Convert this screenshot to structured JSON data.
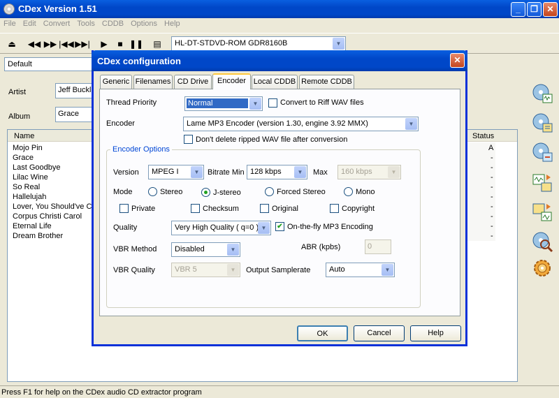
{
  "app": {
    "title": "CDex Version 1.51",
    "menu": [
      "File",
      "Edit",
      "Convert",
      "Tools",
      "CDDB",
      "Options",
      "Help"
    ],
    "drive": "HL-DT-STDVD-ROM GDR8160B",
    "profile": "Default",
    "artist_label": "Artist",
    "artist_value": "Jeff Buckl",
    "album_label": "Album",
    "album_value": "Grace",
    "list": {
      "col_name": "Name",
      "col_status": "Status",
      "tracks": [
        {
          "name": "Mojo Pin",
          "status": "A"
        },
        {
          "name": "Grace",
          "status": "-"
        },
        {
          "name": "Last Goodbye",
          "status": "-"
        },
        {
          "name": "Lilac Wine",
          "status": "-"
        },
        {
          "name": "So Real",
          "status": "-"
        },
        {
          "name": "Hallelujah",
          "status": "-"
        },
        {
          "name": "Lover, You Should've C",
          "status": "-"
        },
        {
          "name": "Corpus Christi Carol",
          "status": "-"
        },
        {
          "name": "Eternal Life",
          "status": "-"
        },
        {
          "name": "Dream Brother",
          "status": "-"
        }
      ]
    },
    "statusbar": "Press F1 for help on the CDex audio CD extractor program"
  },
  "dialog": {
    "title": "CDex configuration",
    "tabs": [
      "Generic",
      "Filenames",
      "CD Drive",
      "Encoder",
      "Local CDDB",
      "Remote CDDB"
    ],
    "active_tab": "Encoder",
    "thread_priority_label": "Thread Priority",
    "thread_priority_value": "Normal",
    "convert_riff_label": "Convert to Riff WAV files",
    "encoder_label": "Encoder",
    "encoder_value": "Lame MP3 Encoder (version 1.30, engine 3.92 MMX)",
    "dont_delete_label": "Don't delete ripped WAV file after conversion",
    "group_title": "Encoder Options",
    "version_label": "Version",
    "version_value": "MPEG I",
    "bitrate_min_label": "Bitrate Min",
    "bitrate_min_value": "128 kbps",
    "max_label": "Max",
    "max_value": "160 kbps",
    "mode_label": "Mode",
    "mode_options": [
      "Stereo",
      "J-stereo",
      "Forced Stereo",
      "Mono"
    ],
    "private_label": "Private",
    "checksum_label": "Checksum",
    "original_label": "Original",
    "copyright_label": "Copyright",
    "quality_label": "Quality",
    "quality_value": "Very High Quality ( q=0 )",
    "onthefly_label": "On-the-fly MP3 Encoding",
    "vbr_method_label": "VBR Method",
    "vbr_method_value": "Disabled",
    "abr_label": "ABR (kpbs)",
    "abr_value": "0",
    "vbr_quality_label": "VBR Quality",
    "vbr_quality_value": "VBR 5",
    "output_samplerate_label": "Output Samplerate",
    "output_samplerate_value": "Auto",
    "ok_label": "OK",
    "cancel_label": "Cancel",
    "help_label": "Help"
  },
  "colors": {
    "titlebar": "#0047c8",
    "dialog_border": "#0831d9",
    "selection": "#316ac5",
    "group_title": "#0046d5"
  }
}
